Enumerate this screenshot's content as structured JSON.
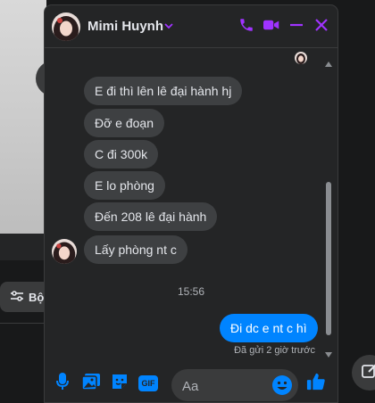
{
  "background": {
    "filter_label": "Bộ"
  },
  "chat": {
    "contact_name": "Mimi Huynh",
    "accent": "#a033ff",
    "messages": [
      {
        "text": "E đi thì lên lê đại hành hj",
        "sender": "them"
      },
      {
        "text": "Đỡ e đoạn",
        "sender": "them"
      },
      {
        "text": "C đi 300k",
        "sender": "them"
      },
      {
        "text": "E lo phòng",
        "sender": "them"
      },
      {
        "text": "Đến 208 lê đại hành",
        "sender": "them"
      },
      {
        "text": "Lấy phòng nt c",
        "sender": "them"
      },
      {
        "text": "Đi dc e nt c hì",
        "sender": "me"
      }
    ],
    "timestamp": "15:56",
    "sent_status": "Đã gửi 2 giờ trước",
    "composer": {
      "placeholder": "Aa",
      "gif_label": "GIF"
    }
  }
}
